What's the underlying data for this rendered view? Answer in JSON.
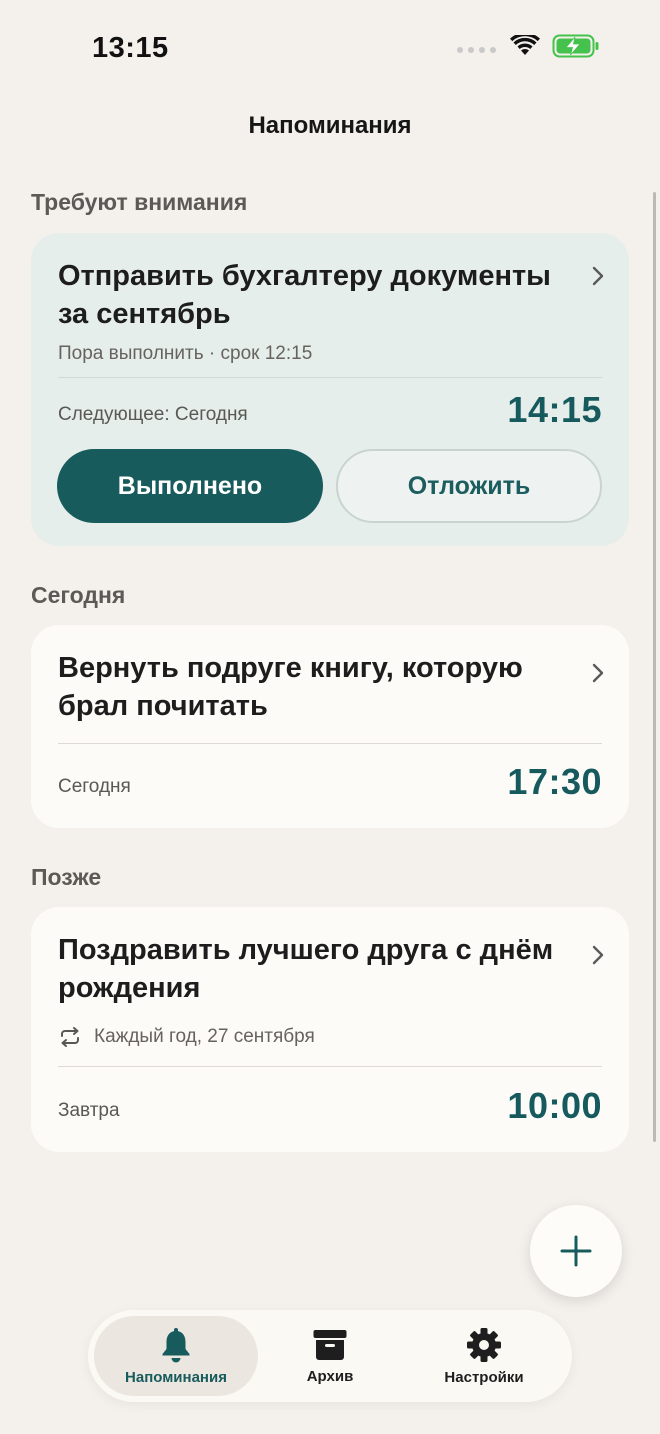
{
  "status_bar": {
    "time": "13:15"
  },
  "header": {
    "title": "Напоминания"
  },
  "sections": {
    "attention": {
      "label": "Требуют внимания",
      "card": {
        "title": "Отправить бухгалтеру документы за сентябрь",
        "subtitle": "Пора выполнить · срок 12:15",
        "next_label": "Следующее: Сегодня",
        "time": "14:15",
        "done_label": "Выполнено",
        "snooze_label": "Отложить"
      }
    },
    "today": {
      "label": "Сегодня",
      "card": {
        "title": "Вернуть подруге книгу, которую брал почитать",
        "day": "Сегодня",
        "time": "17:30"
      }
    },
    "later": {
      "label": "Позже",
      "card": {
        "title": "Поздравить лучшего друга с днём рождения",
        "repeat": "Каждый год, 27 сентября",
        "day": "Завтра",
        "time": "10:00"
      }
    }
  },
  "fab": {
    "icon": "plus-icon"
  },
  "tabs": [
    {
      "label": "Напоминания",
      "icon": "bell-icon",
      "active": true
    },
    {
      "label": "Архив",
      "icon": "archive-icon",
      "active": false
    },
    {
      "label": "Настройки",
      "icon": "gear-icon",
      "active": false
    }
  ],
  "colors": {
    "accent": "#175b5d",
    "background": "#f4f1ec",
    "card": "#fcfbf7",
    "attention_card": "#e6eeeb"
  }
}
